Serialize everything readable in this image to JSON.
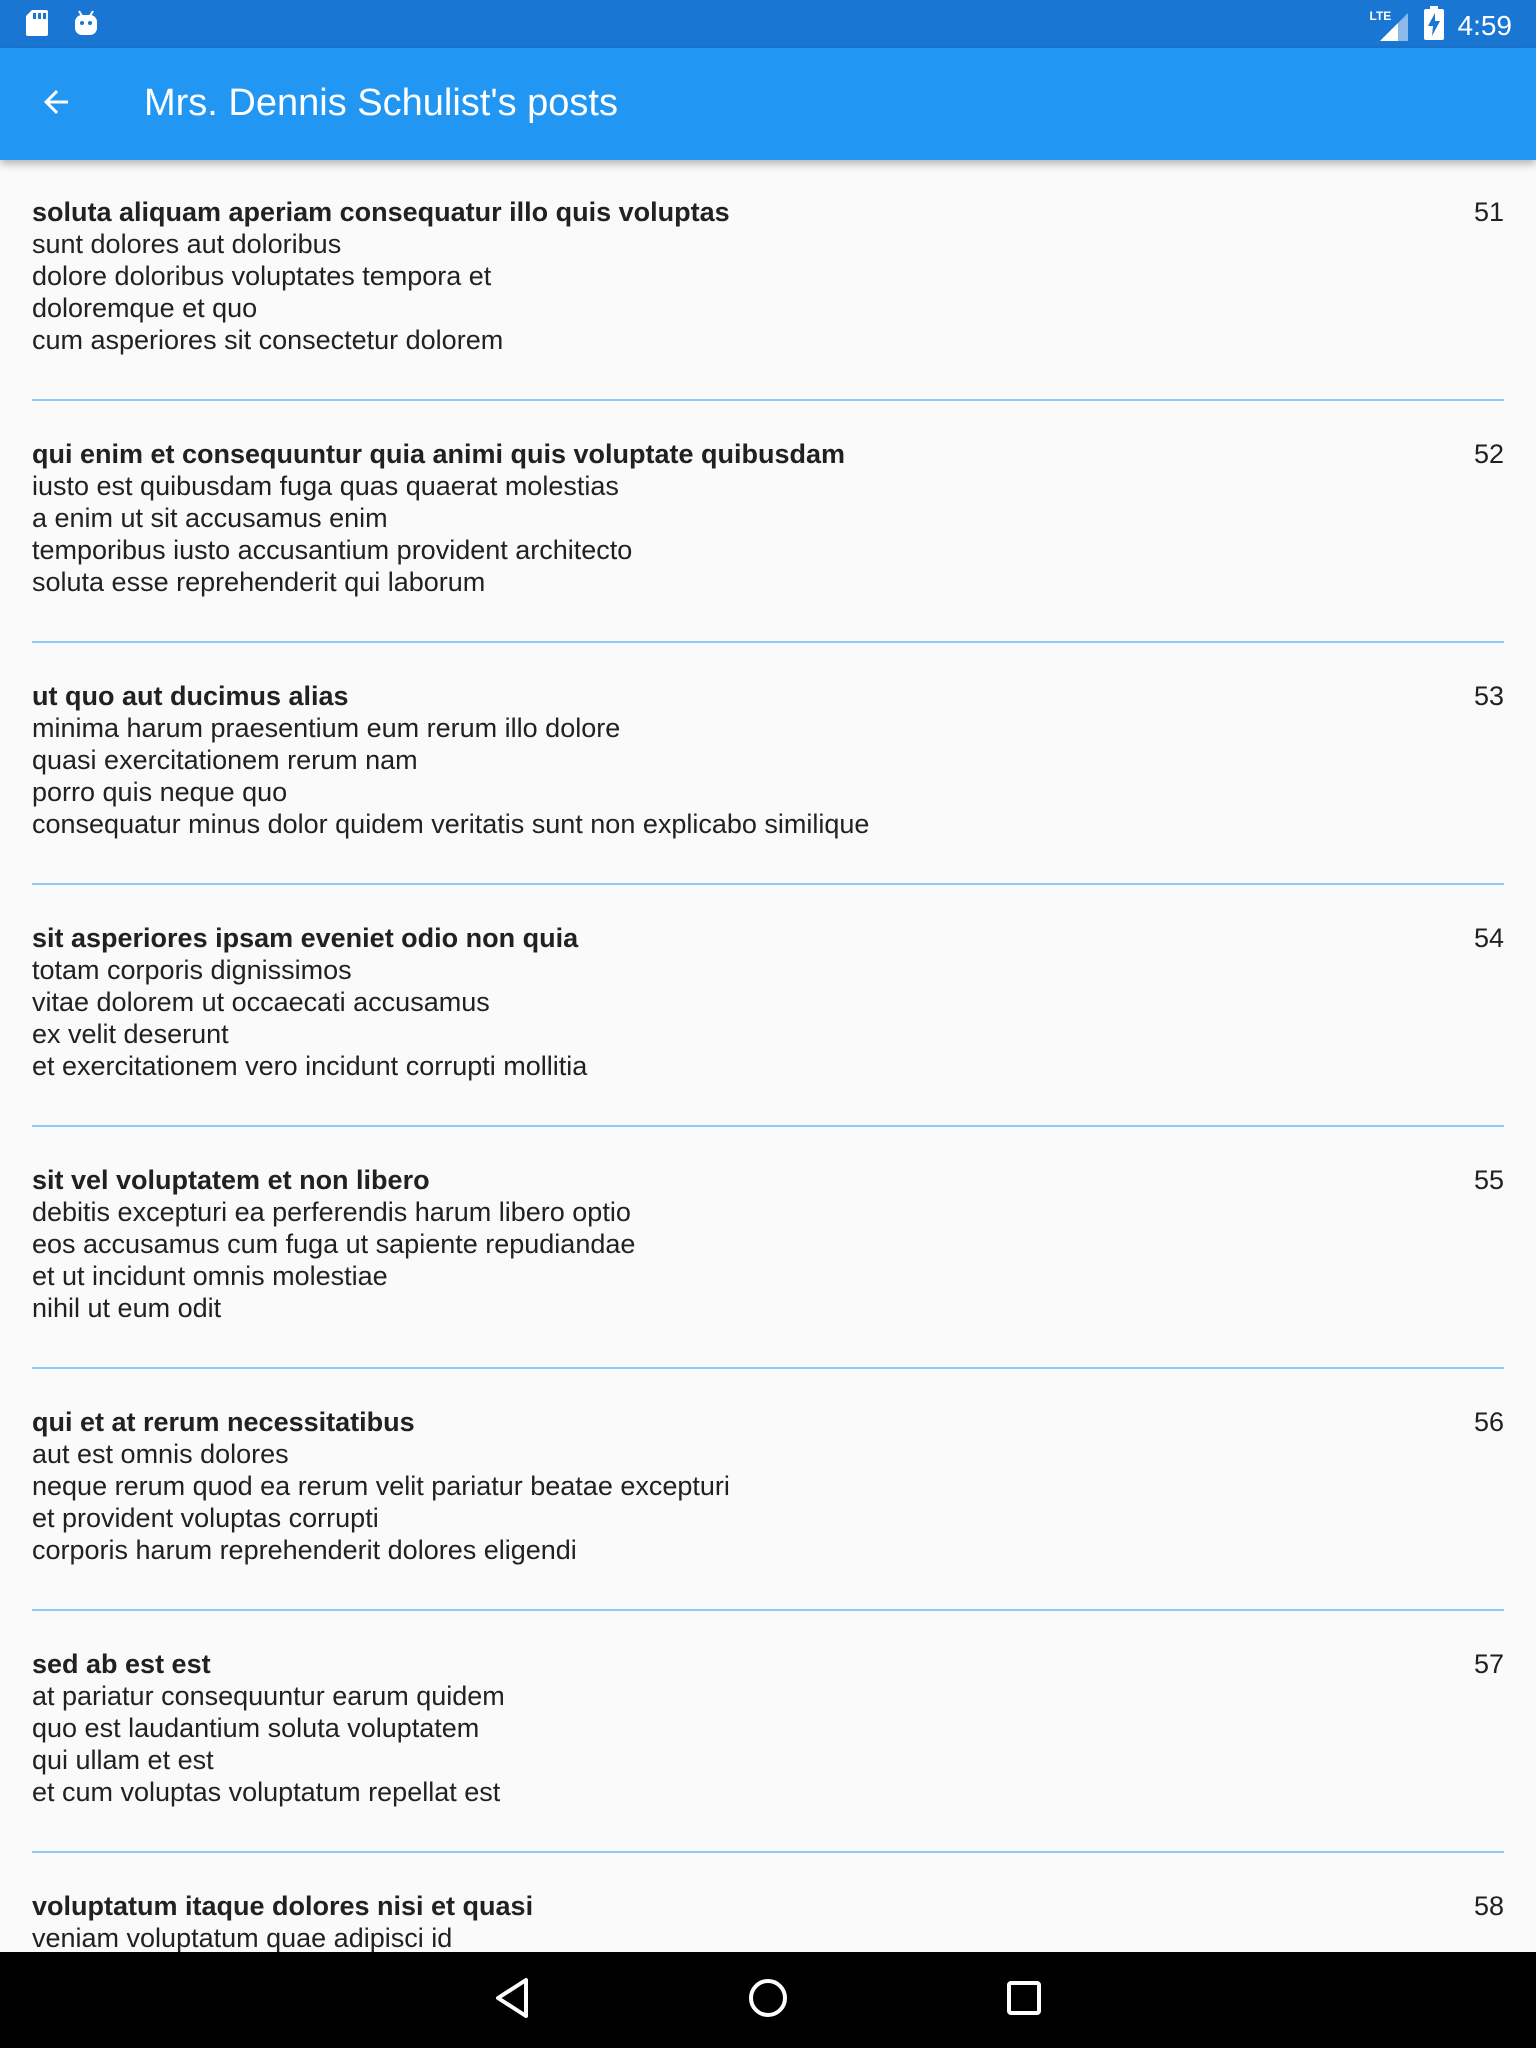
{
  "status_bar": {
    "time": "4:59",
    "network": "LTE",
    "left_icons": [
      "sd-card-icon",
      "android-debug-icon"
    ],
    "right_icons": [
      "lte-signal-icon",
      "battery-charging-icon"
    ]
  },
  "app_bar": {
    "title": "Mrs. Dennis Schulist's posts",
    "back_icon": "arrow-back-icon"
  },
  "posts": [
    {
      "id": "51",
      "title": "soluta aliquam aperiam consequatur illo quis voluptas",
      "body": [
        "sunt dolores aut doloribus",
        "dolore doloribus voluptates tempora et",
        "doloremque et quo",
        "cum asperiores sit consectetur dolorem"
      ]
    },
    {
      "id": "52",
      "title": "qui enim et consequuntur quia animi quis voluptate quibusdam",
      "body": [
        "iusto est quibusdam fuga quas quaerat molestias",
        "a enim ut sit accusamus enim",
        "temporibus iusto accusantium provident architecto",
        "soluta esse reprehenderit qui laborum"
      ]
    },
    {
      "id": "53",
      "title": "ut quo aut ducimus alias",
      "body": [
        "minima harum praesentium eum rerum illo dolore",
        "quasi exercitationem rerum nam",
        "porro quis neque quo",
        "consequatur minus dolor quidem veritatis sunt non explicabo similique"
      ]
    },
    {
      "id": "54",
      "title": "sit asperiores ipsam eveniet odio non quia",
      "body": [
        "totam corporis dignissimos",
        "vitae dolorem ut occaecati accusamus",
        "ex velit deserunt",
        "et exercitationem vero incidunt corrupti mollitia"
      ]
    },
    {
      "id": "55",
      "title": "sit vel voluptatem et non libero",
      "body": [
        "debitis excepturi ea perferendis harum libero optio",
        "eos accusamus cum fuga ut sapiente repudiandae",
        "et ut incidunt omnis molestiae",
        "nihil ut eum odit"
      ]
    },
    {
      "id": "56",
      "title": "qui et at rerum necessitatibus",
      "body": [
        "aut est omnis dolores",
        "neque rerum quod ea rerum velit pariatur beatae excepturi",
        "et provident voluptas corrupti",
        "corporis harum reprehenderit dolores eligendi"
      ]
    },
    {
      "id": "57",
      "title": "sed ab est est",
      "body": [
        "at pariatur consequuntur earum quidem",
        "quo est laudantium soluta voluptatem",
        "qui ullam et est",
        "et cum voluptas voluptatum repellat est"
      ]
    },
    {
      "id": "58",
      "title": "voluptatum itaque dolores nisi et quasi",
      "body": [
        "veniam voluptatum quae adipisci id",
        "",
        "",
        ""
      ]
    }
  ],
  "nav_bar": {
    "icons": [
      "back-triangle-icon",
      "home-circle-icon",
      "recents-square-icon"
    ]
  }
}
